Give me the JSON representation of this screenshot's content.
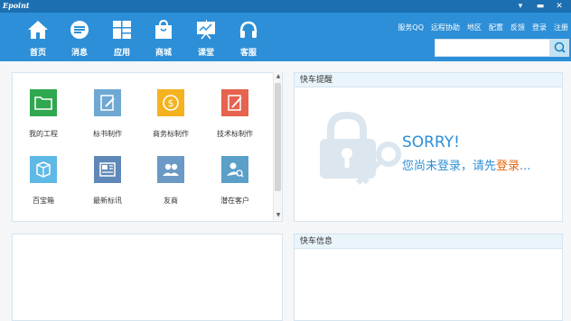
{
  "window": {
    "logo": "Epoint",
    "controls": {
      "minimize": "▾",
      "restore": "▬",
      "close": "✕"
    }
  },
  "nav": [
    {
      "label": "首页",
      "icon": "home-icon"
    },
    {
      "label": "消息",
      "icon": "message-icon"
    },
    {
      "label": "应用",
      "icon": "apps-icon"
    },
    {
      "label": "商城",
      "icon": "shop-bag-icon"
    },
    {
      "label": "课堂",
      "icon": "classroom-board-icon"
    },
    {
      "label": "客服",
      "icon": "headset-icon"
    }
  ],
  "top_links": [
    "服务QQ",
    "远程协助",
    "地区",
    "配置",
    "反馈",
    "登录",
    "注册"
  ],
  "search": {
    "placeholder": ""
  },
  "apps": [
    {
      "label": "我的工程",
      "icon": "folder-icon",
      "color": "#2fa84f"
    },
    {
      "label": "标书制作",
      "icon": "edit-document-icon",
      "color": "#6fa8d2"
    },
    {
      "label": "商务标制作",
      "icon": "coin-icon",
      "color": "#f4b21f"
    },
    {
      "label": "技术标制作",
      "icon": "pencil-document-icon",
      "color": "#e5634f"
    },
    {
      "label": "百宝箱",
      "icon": "toolbox-icon",
      "color": "#5fb9e6"
    },
    {
      "label": "最新标讯",
      "icon": "news-icon",
      "color": "#5f88b8"
    },
    {
      "label": "友商",
      "icon": "partners-icon",
      "color": "#6b9ac6"
    },
    {
      "label": "潜在客户",
      "icon": "customer-search-icon",
      "color": "#5aa0c9"
    }
  ],
  "panels": {
    "reminder_title": "快车提醒",
    "info_title": "快车信息"
  },
  "login_prompt": {
    "sorry": "SORRY!",
    "message": "您尚未登录，请先",
    "link": "登录",
    "ellipsis": "..."
  }
}
